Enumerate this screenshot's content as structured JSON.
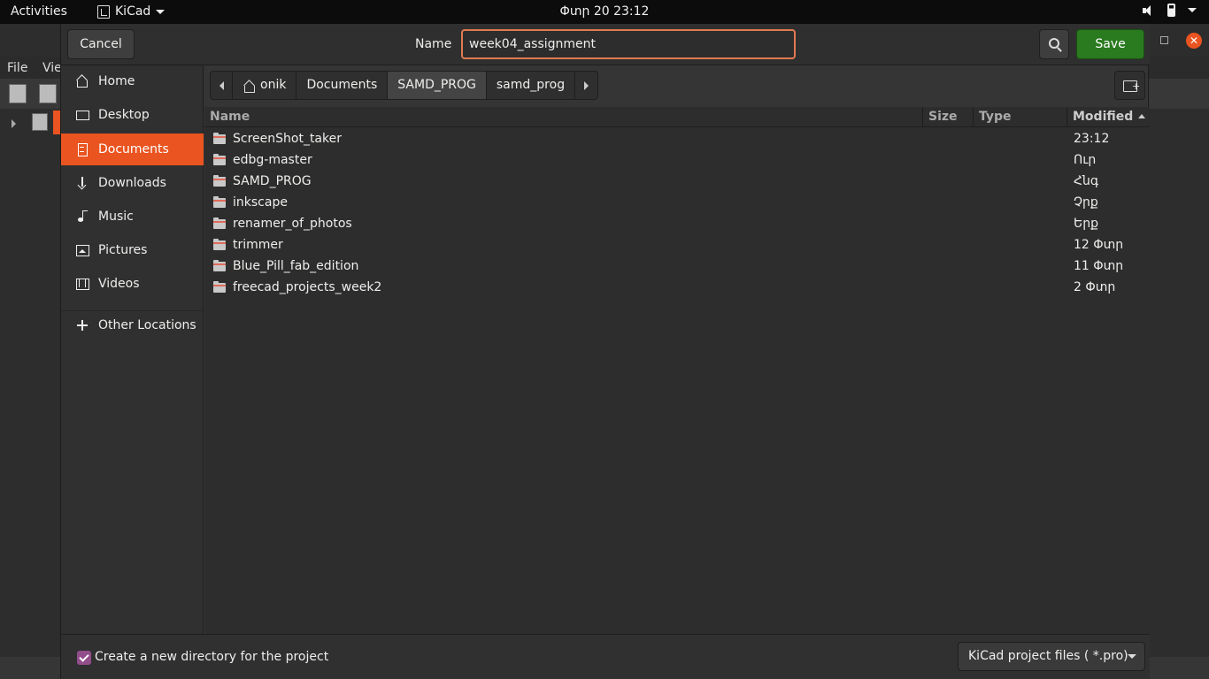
{
  "topbar": {
    "activities": "Activities",
    "app_name": "KiCad",
    "clock": "Փտր 20  23:12"
  },
  "background_window": {
    "menu_file": "File",
    "menu_view": "Vie",
    "accent": "#e95420"
  },
  "dialog": {
    "cancel_label": "Cancel",
    "name_label": "Name",
    "name_value": "week04_assignment",
    "save_label": "Save",
    "save_color": "#2a7a1f"
  },
  "sidebar": {
    "items": [
      {
        "label": "Home",
        "icon": "home-icon"
      },
      {
        "label": "Desktop",
        "icon": "desktop-icon"
      },
      {
        "label": "Documents",
        "icon": "documents-icon",
        "active": true
      },
      {
        "label": "Downloads",
        "icon": "downloads-icon"
      },
      {
        "label": "Music",
        "icon": "music-icon"
      },
      {
        "label": "Pictures",
        "icon": "pictures-icon"
      },
      {
        "label": "Videos",
        "icon": "videos-icon"
      }
    ],
    "other_locations": "Other Locations"
  },
  "path": [
    "onik",
    "Documents",
    "SAMD_PROG",
    "samd_prog"
  ],
  "columns": {
    "name": "Name",
    "size": "Size",
    "type": "Type",
    "modified": "Modified"
  },
  "files": [
    {
      "name": "ScreenShot_taker",
      "modified": "23:12"
    },
    {
      "name": "edbg-master",
      "modified": "Ուր"
    },
    {
      "name": "SAMD_PROG",
      "modified": "Հնգ"
    },
    {
      "name": "inkscape",
      "modified": "Չրք"
    },
    {
      "name": "renamer_of_photos",
      "modified": "Երք"
    },
    {
      "name": "trimmer",
      "modified": "12 Փտր"
    },
    {
      "name": "Blue_Pill_fab_edition",
      "modified": "11 Փտր"
    },
    {
      "name": "freecad_projects_week2",
      "modified": "2 Փտր"
    }
  ],
  "footer": {
    "checkbox_label": "Create a new directory for the project",
    "checkbox_checked": true,
    "filter_label": "KiCad project files ( *.pro)"
  }
}
